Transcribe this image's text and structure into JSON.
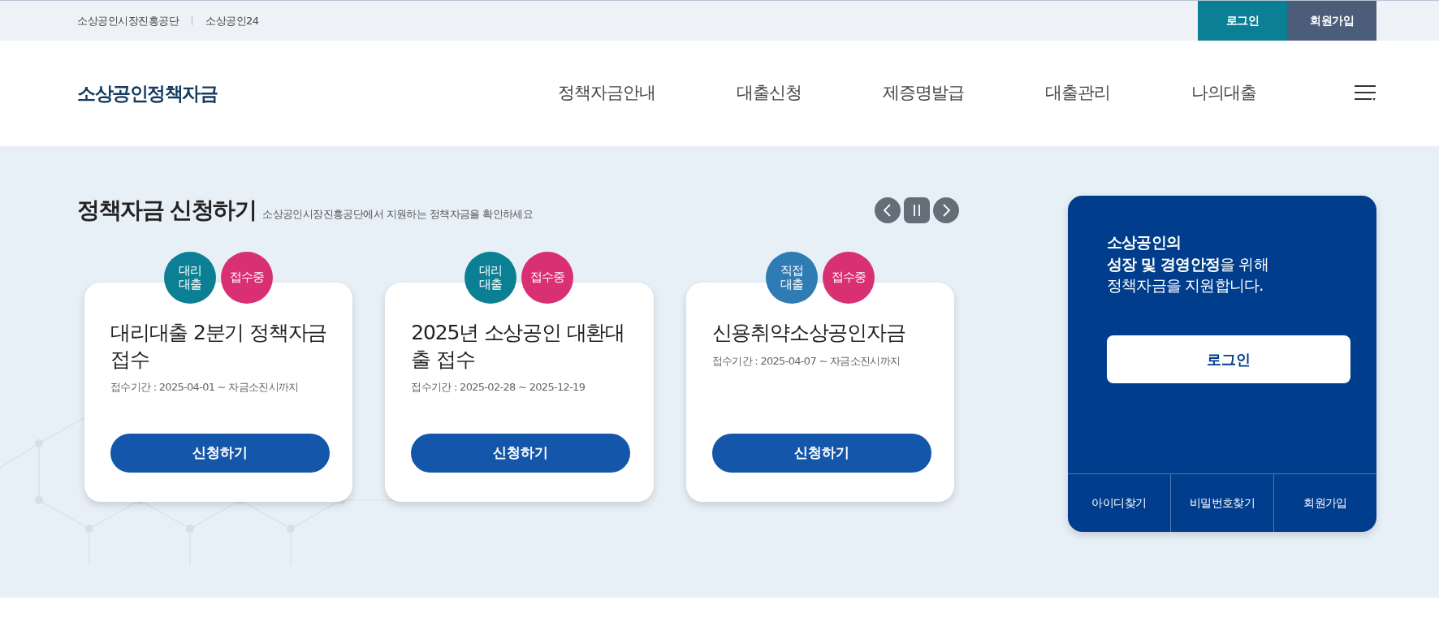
{
  "top_links": [
    "소상공인시장진흥공단",
    "소상공인24"
  ],
  "top_buttons": [
    {
      "label": "로그인",
      "kind": "primary"
    },
    {
      "label": "회원가입",
      "kind": "secondary"
    }
  ],
  "logo": "소상공인정책자금",
  "nav": [
    "정책자금안내",
    "대출신청",
    "제증명발급",
    "대출관리",
    "나의대출"
  ],
  "section": {
    "title": "정책자금 신청하기",
    "subtitle": "소상공인시장진흥공단에서 지원하는 정책자금을 확인하세요"
  },
  "cards": [
    {
      "badges": [
        {
          "label": "대리 대출",
          "color": "#0b8094"
        },
        {
          "label": "접수중",
          "color": "#d92f73"
        }
      ],
      "title": "대리대출 2분기 정책자금 접수",
      "period": "접수기간 : 2025-04-01 ~ 자금소진시까지",
      "button": "신청하기"
    },
    {
      "badges": [
        {
          "label": "대리 대출",
          "color": "#0b8094"
        },
        {
          "label": "접수중",
          "color": "#d92f73"
        }
      ],
      "title": "2025년 소상공인 대환대출 접수",
      "period": "접수기간 : 2025-02-28 ~ 2025-12-19",
      "button": "신청하기"
    },
    {
      "badges": [
        {
          "label": "직접 대출",
          "color": "#2f7bb3"
        },
        {
          "label": "접수중",
          "color": "#d92f73"
        }
      ],
      "title": "신용취약소상공인자금",
      "period": "접수기간 : 2025-04-07 ~ 자금소진시까지",
      "button": "신청하기"
    }
  ],
  "login_panel": {
    "message": "**소상공인의**\n**성장 및 경영안정**을 위해\n정책자금을 지원합니다.",
    "button": "로그인",
    "links": [
      "아이디찾기",
      "비밀번호찾기",
      "회원가입"
    ]
  }
}
